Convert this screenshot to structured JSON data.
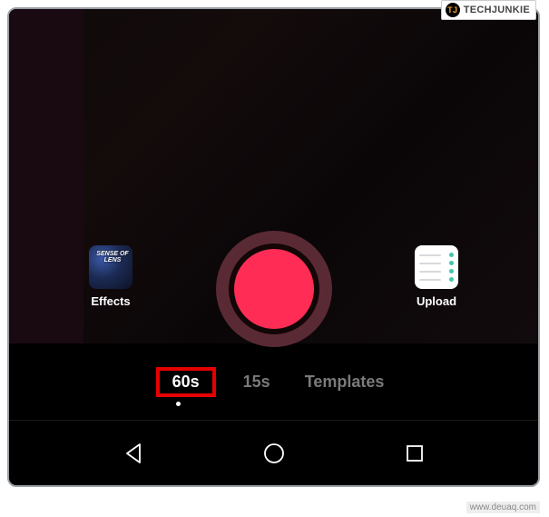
{
  "watermark": {
    "brand_short": "TJ",
    "brand": "TECHJUNKIE"
  },
  "effects": {
    "label": "Effects",
    "thumb_text": "SENSE\nOF\nLENS"
  },
  "upload": {
    "label": "Upload"
  },
  "modes": {
    "items": [
      {
        "label": "60s",
        "active": true,
        "highlighted": true
      },
      {
        "label": "15s",
        "active": false,
        "highlighted": false
      },
      {
        "label": "Templates",
        "active": false,
        "highlighted": false
      }
    ]
  },
  "footer": {
    "url": "www.deuaq.com"
  }
}
